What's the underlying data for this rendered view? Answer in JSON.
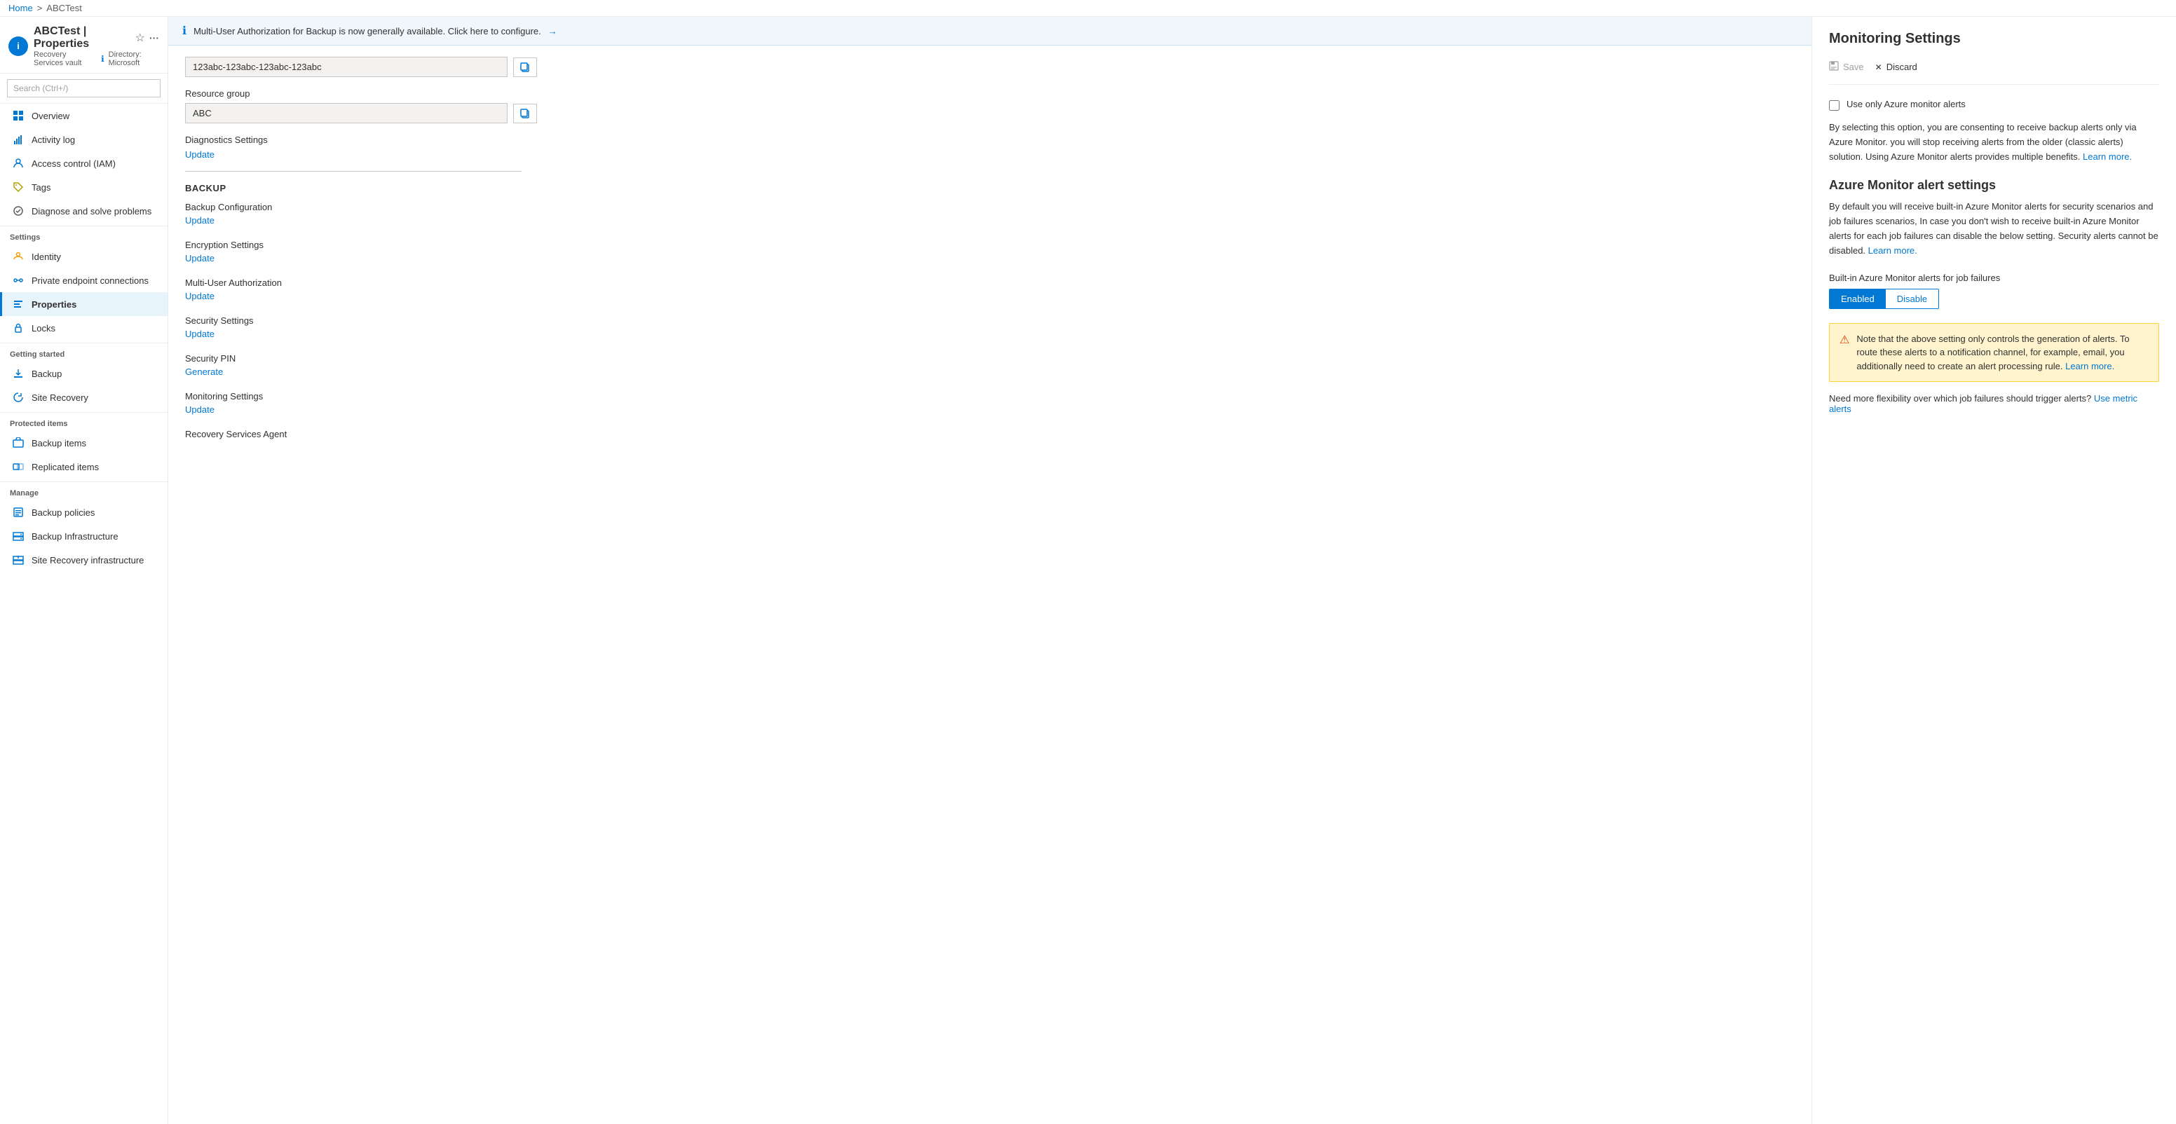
{
  "breadcrumb": {
    "home": "Home",
    "separator": ">",
    "current": "ABCTest"
  },
  "header": {
    "icon_letter": "i",
    "title": "ABCTest | Properties",
    "subtitle": "Recovery Services vault",
    "directory_label": "Directory: Microsoft",
    "info_icon": "ℹ",
    "star_icon": "☆",
    "ellipsis_icon": "···"
  },
  "sidebar": {
    "search_placeholder": "Search (Ctrl+/)",
    "collapse_icon": "«",
    "items": [
      {
        "id": "overview",
        "label": "Overview",
        "icon": "overview"
      },
      {
        "id": "activity-log",
        "label": "Activity log",
        "icon": "activity"
      },
      {
        "id": "access-control",
        "label": "Access control (IAM)",
        "icon": "access"
      },
      {
        "id": "tags",
        "label": "Tags",
        "icon": "tags"
      },
      {
        "id": "diagnose",
        "label": "Diagnose and solve problems",
        "icon": "diagnose"
      }
    ],
    "settings_section": "Settings",
    "settings_items": [
      {
        "id": "identity",
        "label": "Identity",
        "icon": "identity"
      },
      {
        "id": "private-endpoints",
        "label": "Private endpoint connections",
        "icon": "endpoints"
      },
      {
        "id": "properties",
        "label": "Properties",
        "icon": "properties",
        "active": true
      },
      {
        "id": "locks",
        "label": "Locks",
        "icon": "locks"
      }
    ],
    "getting_started_section": "Getting started",
    "getting_started_items": [
      {
        "id": "backup",
        "label": "Backup",
        "icon": "backup"
      },
      {
        "id": "site-recovery",
        "label": "Site Recovery",
        "icon": "site-recovery"
      }
    ],
    "protected_section": "Protected items",
    "protected_items": [
      {
        "id": "backup-items",
        "label": "Backup items",
        "icon": "backup-items"
      },
      {
        "id": "replicated-items",
        "label": "Replicated items",
        "icon": "replicated-items"
      }
    ],
    "manage_section": "Manage",
    "manage_items": [
      {
        "id": "backup-policies",
        "label": "Backup policies",
        "icon": "policies"
      },
      {
        "id": "backup-infrastructure",
        "label": "Backup Infrastructure",
        "icon": "infrastructure"
      },
      {
        "id": "site-recovery-infra",
        "label": "Site Recovery infrastructure",
        "icon": "sr-infra"
      }
    ]
  },
  "notification": {
    "icon": "ℹ",
    "text": "Multi-User Authorization for Backup is now generally available. Click here to configure.",
    "arrow": "→"
  },
  "properties": {
    "resource_id_value": "123abc-123abc-123abc-123abc",
    "resource_group_label": "Resource group",
    "resource_group_value": "ABC",
    "diagnostics_label": "Diagnostics Settings",
    "diagnostics_link": "Update",
    "backup_section_title": "BACKUP",
    "backup_config_label": "Backup Configuration",
    "backup_config_link": "Update",
    "encryption_label": "Encryption Settings",
    "encryption_link": "Update",
    "mua_label": "Multi-User Authorization",
    "mua_link": "Update",
    "security_settings_label": "Security Settings",
    "security_settings_link": "Update",
    "security_pin_label": "Security PIN",
    "security_pin_link": "Generate",
    "monitoring_label": "Monitoring Settings",
    "monitoring_link": "Update",
    "agent_label": "Recovery Services Agent"
  },
  "right_panel": {
    "title": "Monitoring Settings",
    "save_label": "Save",
    "discard_label": "Discard",
    "save_icon": "💾",
    "discard_icon": "✕",
    "checkbox_label": "Use only Azure monitor alerts",
    "description": "By selecting this option, you are consenting to receive backup alerts only via Azure Monitor. you will stop receiving alerts from the older (classic alerts) solution. Using Azure Monitor alerts provides multiple benefits.",
    "learn_more_1": "Learn more.",
    "azure_monitor_section": "Azure Monitor alert settings",
    "azure_monitor_description": "By default you will receive built-in Azure Monitor alerts for security scenarios and job failures scenarios, In case you don't wish to receive built-in Azure Monitor alerts for each job failures can disable the below setting. Security alerts cannot be disabled.",
    "learn_more_2": "Learn more.",
    "toggle_label": "Built-in Azure Monitor alerts for job failures",
    "enabled_label": "Enabled",
    "disable_label": "Disable",
    "warning_text": "Note that the above setting only controls the generation of alerts. To route these alerts to a notification channel, for example, email, you additionally need to create an alert processing rule.",
    "learn_more_3": "Learn more.",
    "flexibility_text": "Need more flexibility over which job failures should trigger alerts?",
    "metric_alerts_link": "Use metric alerts"
  }
}
